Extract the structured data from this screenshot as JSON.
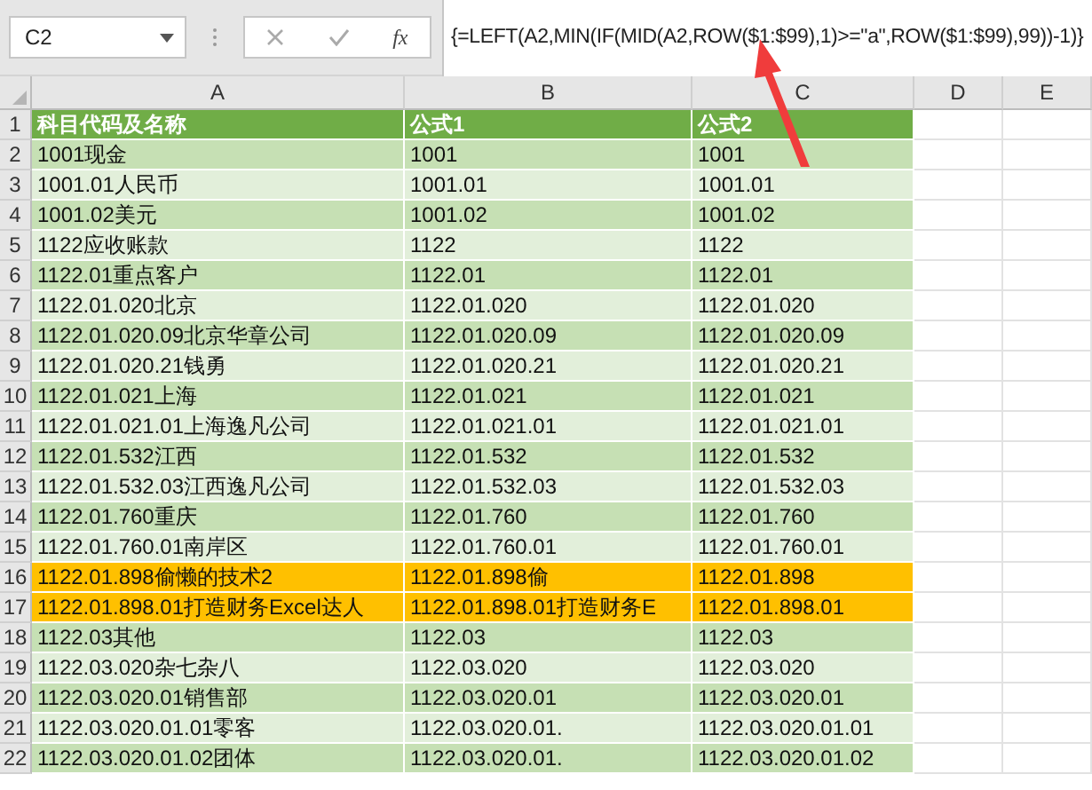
{
  "name_box": {
    "value": "C2"
  },
  "formula_bar": {
    "function_label": "fx",
    "formula": "{=LEFT(A2,MIN(IF(MID(A2,ROW($1:$99),1)>=\"a\",ROW($1:$99),99))-1)}"
  },
  "columns": [
    "A",
    "B",
    "C",
    "D",
    "E"
  ],
  "rows": [
    {
      "number": "1",
      "kind": "header",
      "cells": [
        "科目代码及名称",
        "公式1",
        "公式2"
      ]
    },
    {
      "number": "2",
      "kind": "data",
      "cells": [
        "1001现金",
        "1001",
        "1001"
      ]
    },
    {
      "number": "3",
      "kind": "data",
      "cells": [
        "1001.01人民币",
        "1001.01",
        "1001.01"
      ]
    },
    {
      "number": "4",
      "kind": "data",
      "cells": [
        "1001.02美元",
        "1001.02",
        "1001.02"
      ]
    },
    {
      "number": "5",
      "kind": "data",
      "cells": [
        "1122应收账款",
        "1122",
        "1122"
      ]
    },
    {
      "number": "6",
      "kind": "data",
      "cells": [
        "1122.01重点客户",
        "1122.01",
        "1122.01"
      ]
    },
    {
      "number": "7",
      "kind": "data",
      "cells": [
        "1122.01.020北京",
        "1122.01.020",
        "1122.01.020"
      ]
    },
    {
      "number": "8",
      "kind": "data",
      "cells": [
        "1122.01.020.09北京华章公司",
        "1122.01.020.09",
        "1122.01.020.09"
      ]
    },
    {
      "number": "9",
      "kind": "data",
      "cells": [
        "1122.01.020.21钱勇",
        "1122.01.020.21",
        "1122.01.020.21"
      ]
    },
    {
      "number": "10",
      "kind": "data",
      "cells": [
        "1122.01.021上海",
        "1122.01.021",
        "1122.01.021"
      ]
    },
    {
      "number": "11",
      "kind": "data",
      "cells": [
        "1122.01.021.01上海逸凡公司",
        "1122.01.021.01",
        "1122.01.021.01"
      ]
    },
    {
      "number": "12",
      "kind": "data",
      "cells": [
        "1122.01.532江西",
        "1122.01.532",
        "1122.01.532"
      ]
    },
    {
      "number": "13",
      "kind": "data",
      "cells": [
        "1122.01.532.03江西逸凡公司",
        "1122.01.532.03",
        "1122.01.532.03"
      ]
    },
    {
      "number": "14",
      "kind": "data",
      "cells": [
        "1122.01.760重庆",
        "1122.01.760",
        "1122.01.760"
      ]
    },
    {
      "number": "15",
      "kind": "data",
      "cells": [
        "1122.01.760.01南岸区",
        "1122.01.760.01",
        "1122.01.760.01"
      ]
    },
    {
      "number": "16",
      "kind": "highlight",
      "cells": [
        "1122.01.898偷懒的技术2",
        "1122.01.898偷",
        "1122.01.898"
      ]
    },
    {
      "number": "17",
      "kind": "highlight",
      "cells": [
        "1122.01.898.01打造财务Excel达人",
        "1122.01.898.01打造财务E",
        "1122.01.898.01"
      ]
    },
    {
      "number": "18",
      "kind": "data",
      "cells": [
        "1122.03其他",
        "1122.03",
        "1122.03"
      ]
    },
    {
      "number": "19",
      "kind": "data",
      "cells": [
        "1122.03.020杂七杂八",
        "1122.03.020",
        "1122.03.020"
      ]
    },
    {
      "number": "20",
      "kind": "data",
      "cells": [
        "1122.03.020.01销售部",
        "1122.03.020.01",
        "1122.03.020.01"
      ]
    },
    {
      "number": "21",
      "kind": "data",
      "cells": [
        "1122.03.020.01.01零客",
        "1122.03.020.01.",
        "1122.03.020.01.01"
      ]
    },
    {
      "number": "22",
      "kind": "data",
      "cells": [
        "1122.03.020.01.02团体",
        "1122.03.020.01.",
        "1122.03.020.01.02"
      ]
    }
  ]
}
